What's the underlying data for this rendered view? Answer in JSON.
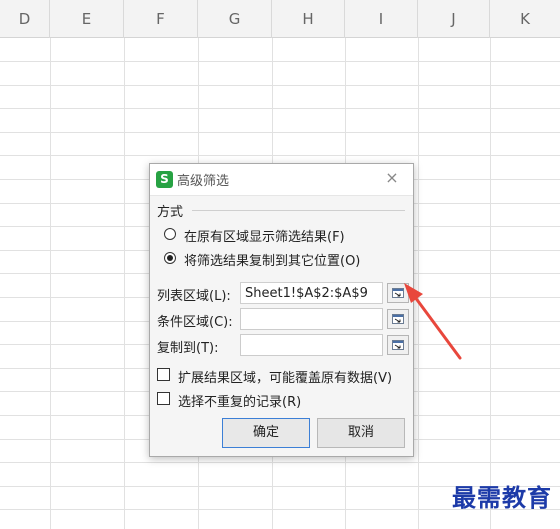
{
  "columns": [
    "D",
    "E",
    "F",
    "G",
    "H",
    "I",
    "J",
    "K"
  ],
  "dialog": {
    "title": "高级筛选",
    "close_symbol": "×",
    "app_logo_letter": "S",
    "app_logo_color": "#27a243",
    "method_group_label": "方式",
    "radio_options": [
      {
        "label": "在原有区域显示筛选结果(F)",
        "checked": false
      },
      {
        "label": "将筛选结果复制到其它位置(O)",
        "checked": true
      }
    ],
    "fields": [
      {
        "label": "列表区域(L):",
        "value": "Sheet1!$A$2:$A$9",
        "icon": "range-picker-icon"
      },
      {
        "label": "条件区域(C):",
        "value": "",
        "icon": "range-picker-icon"
      },
      {
        "label": "复制到(T):",
        "value": "",
        "icon": "range-picker-icon"
      }
    ],
    "checkboxes": [
      {
        "label": "扩展结果区域，可能覆盖原有数据(V)",
        "checked": false
      },
      {
        "label": "选择不重复的记录(R)",
        "checked": false
      }
    ],
    "ok_label": "确定",
    "cancel_label": "取消"
  },
  "annotation": {
    "color": "#e8473c"
  },
  "watermark": "最需教育"
}
